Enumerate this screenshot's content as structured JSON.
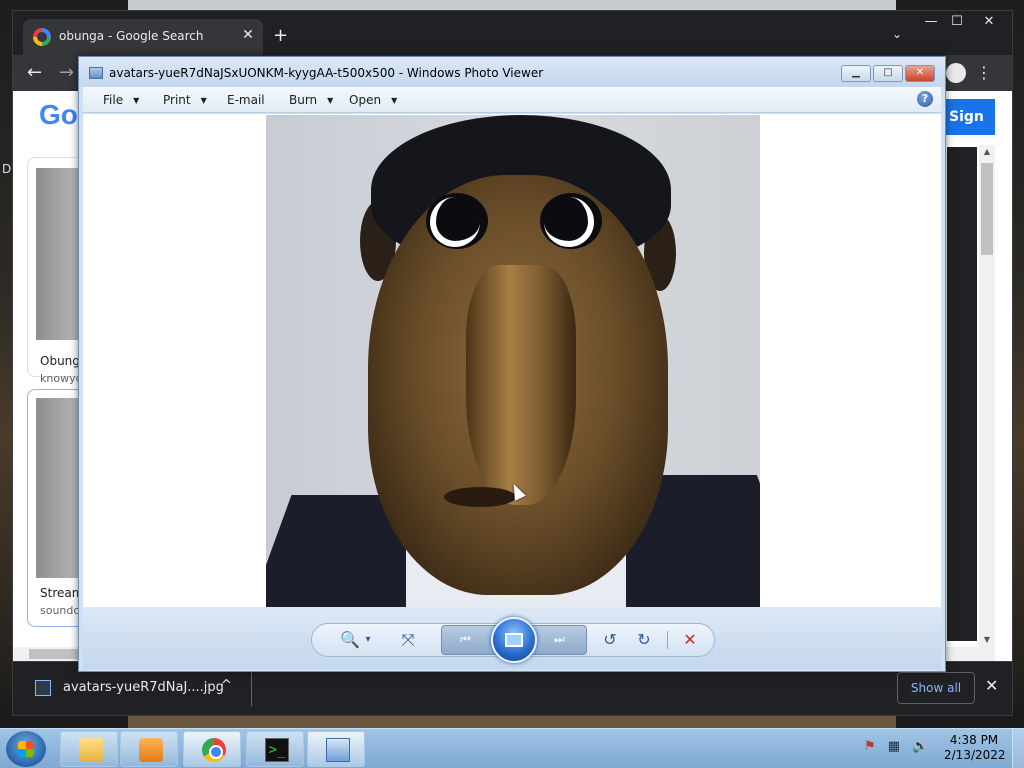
{
  "chrome": {
    "tab_title": "obunga - Google Search",
    "tab_close": "✕",
    "new_tab": "+",
    "window_min": "—",
    "window_max": "☐",
    "window_close": "✕",
    "nav_back": "←",
    "nav_forward": "→",
    "menu": "⋮",
    "tab_search": "⌄",
    "sign_in": "Sign in",
    "google_logo_visible": "Go",
    "left_edge_text": "D",
    "results": [
      {
        "title": "Obunga",
        "source": "knowyo"
      },
      {
        "title": "Stream",
        "source": "soundcl"
      }
    ],
    "download": {
      "filename": "avatars-yueR7dNaJ....jpg",
      "caret": "^",
      "show_all": "Show all",
      "close": "✕"
    }
  },
  "viewer": {
    "title": "avatars-yueR7dNaJSxUONKM-kyygAA-t500x500 - Windows Photo Viewer",
    "menus": [
      "File",
      "Print",
      "E-mail",
      "Burn",
      "Open"
    ],
    "help": "?",
    "btn_min": "▁",
    "btn_max": "□",
    "btn_close": "✕",
    "toolbar": {
      "zoom": "🔍",
      "zoom_arrow": "▾",
      "fit": "⤧",
      "prev": "⏮",
      "next": "⏭",
      "rotate_ccw": "↺",
      "rotate_cw": "↻",
      "delete": "✕"
    }
  },
  "taskbar": {
    "terminal_glyph": ">_",
    "tray_icons": [
      "flag-icon",
      "network-icon",
      "volume-icon"
    ],
    "time": "4:38 PM",
    "date": "2/13/2022"
  }
}
